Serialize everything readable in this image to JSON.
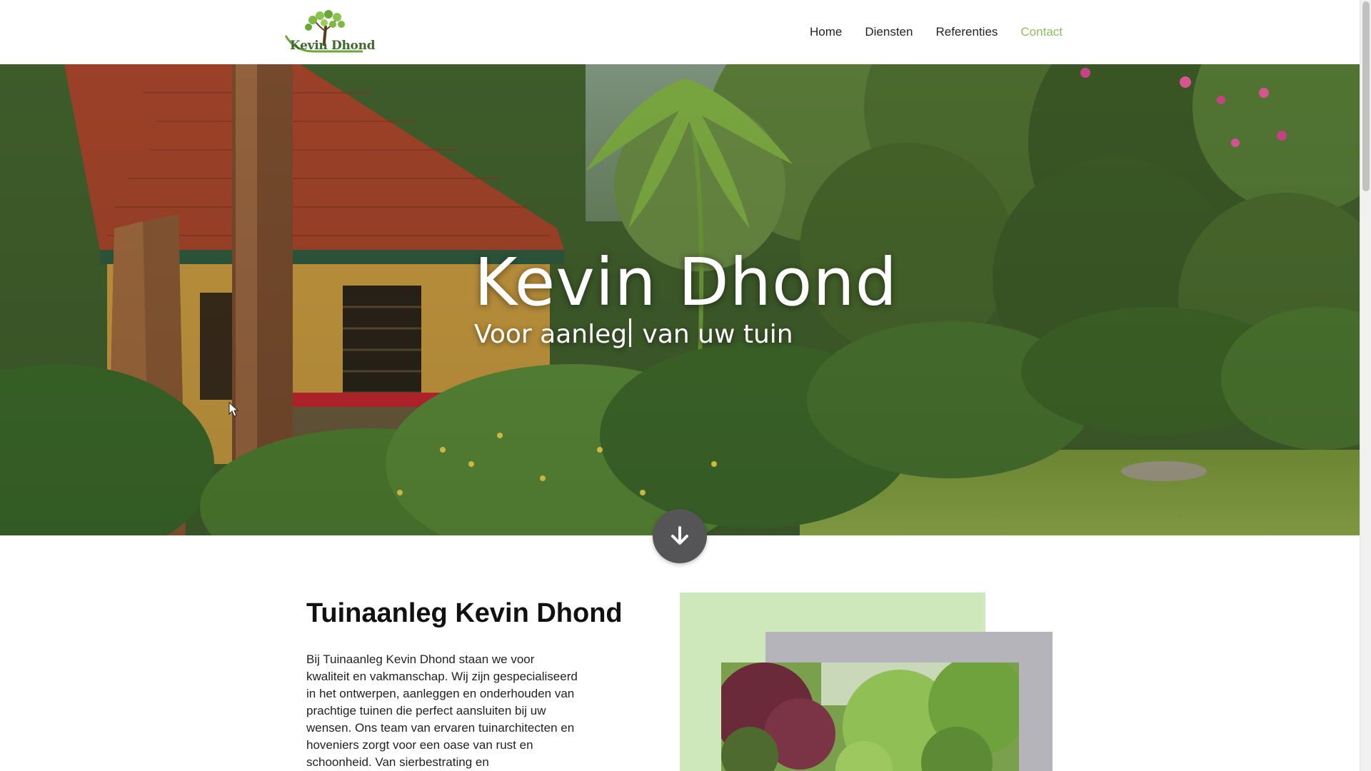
{
  "header": {
    "logo_text": "Kevin Dhond",
    "nav": [
      {
        "label": "Home",
        "active": false
      },
      {
        "label": "Diensten",
        "active": false
      },
      {
        "label": "Referenties",
        "active": false
      },
      {
        "label": "Contact",
        "active": true
      }
    ]
  },
  "hero": {
    "title": "Kevin Dhond",
    "subtitle_typed": "Voor aanleg",
    "subtitle_rest": " van uw tuin",
    "scroll_icon": "arrow-down-icon"
  },
  "about": {
    "title": "Tuinaanleg Kevin Dhond",
    "body": "Bij Tuinaanleg Kevin Dhond staan we voor kwaliteit en vakmanschap. Wij zijn gespecialiseerd in het ontwerpen, aanleggen en onderhouden van prachtige tuinen die perfect aansluiten bij uw wensen. Ons team van ervaren tuinarchitecten en hoveniers zorgt voor een oase van rust en schoonheid. Van sierbestrating en"
  },
  "colors": {
    "accent_green": "#8bbf59",
    "deco_green": "#cfe8bb",
    "deco_gray": "#b4b4ba",
    "scroll_button": "#555558"
  }
}
